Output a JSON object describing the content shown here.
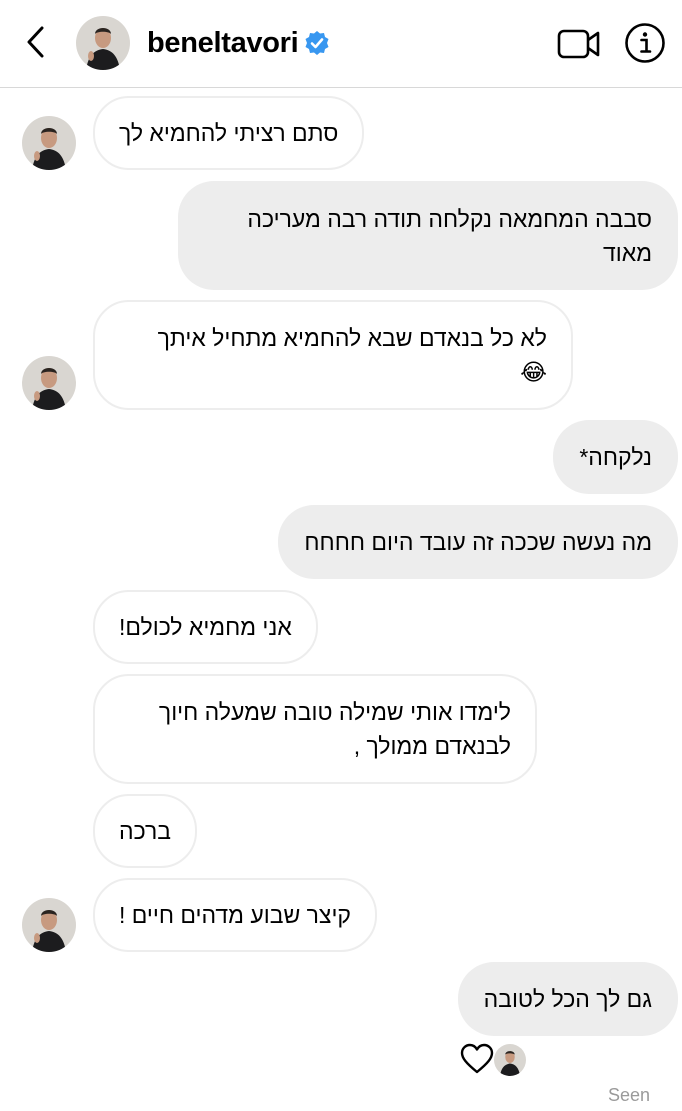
{
  "header": {
    "username": "beneltavori",
    "verified_color": "#3897f0",
    "back_icon": "chevron-left-icon",
    "video_icon": "video-camera-icon",
    "info_icon": "info-icon"
  },
  "messages": [
    {
      "direction": "in",
      "lines": [
        "סתם רציתי להחמיא לך"
      ],
      "avatar": true
    },
    {
      "direction": "out",
      "lines": [
        "סבבה המחמאה נקלחה תודה רבה מעריכה",
        "מאוד"
      ]
    },
    {
      "direction": "in",
      "lines": [
        "לא כל בנאדם שבא להחמיא מתחיל איתך",
        "😂"
      ],
      "avatar": true
    },
    {
      "direction": "out",
      "lines": [
        "נלקחה*"
      ]
    },
    {
      "direction": "out",
      "lines": [
        "מה נעשה שככה זה עובד היום חחחח"
      ]
    },
    {
      "direction": "in",
      "lines": [
        "אני מחמיא לכולם!"
      ]
    },
    {
      "direction": "in",
      "lines": [
        "לימדו אותי שמילה טובה שמעלה חיוך",
        "לבנאדם ממולך ,"
      ]
    },
    {
      "direction": "in",
      "lines": [
        "ברכה"
      ]
    },
    {
      "direction": "in",
      "lines": [
        "קיצר שבוע מדהים חיים !"
      ],
      "avatar": true
    },
    {
      "direction": "out",
      "lines": [
        "גם לך הכל לטובה"
      ]
    }
  ],
  "reaction": {
    "icon": "heart-outline-icon"
  },
  "status": {
    "seen": "Seen"
  },
  "colors": {
    "outgoing_bubble": "#ededed",
    "incoming_border": "#ededed",
    "seen_text": "#9a9a9a"
  }
}
